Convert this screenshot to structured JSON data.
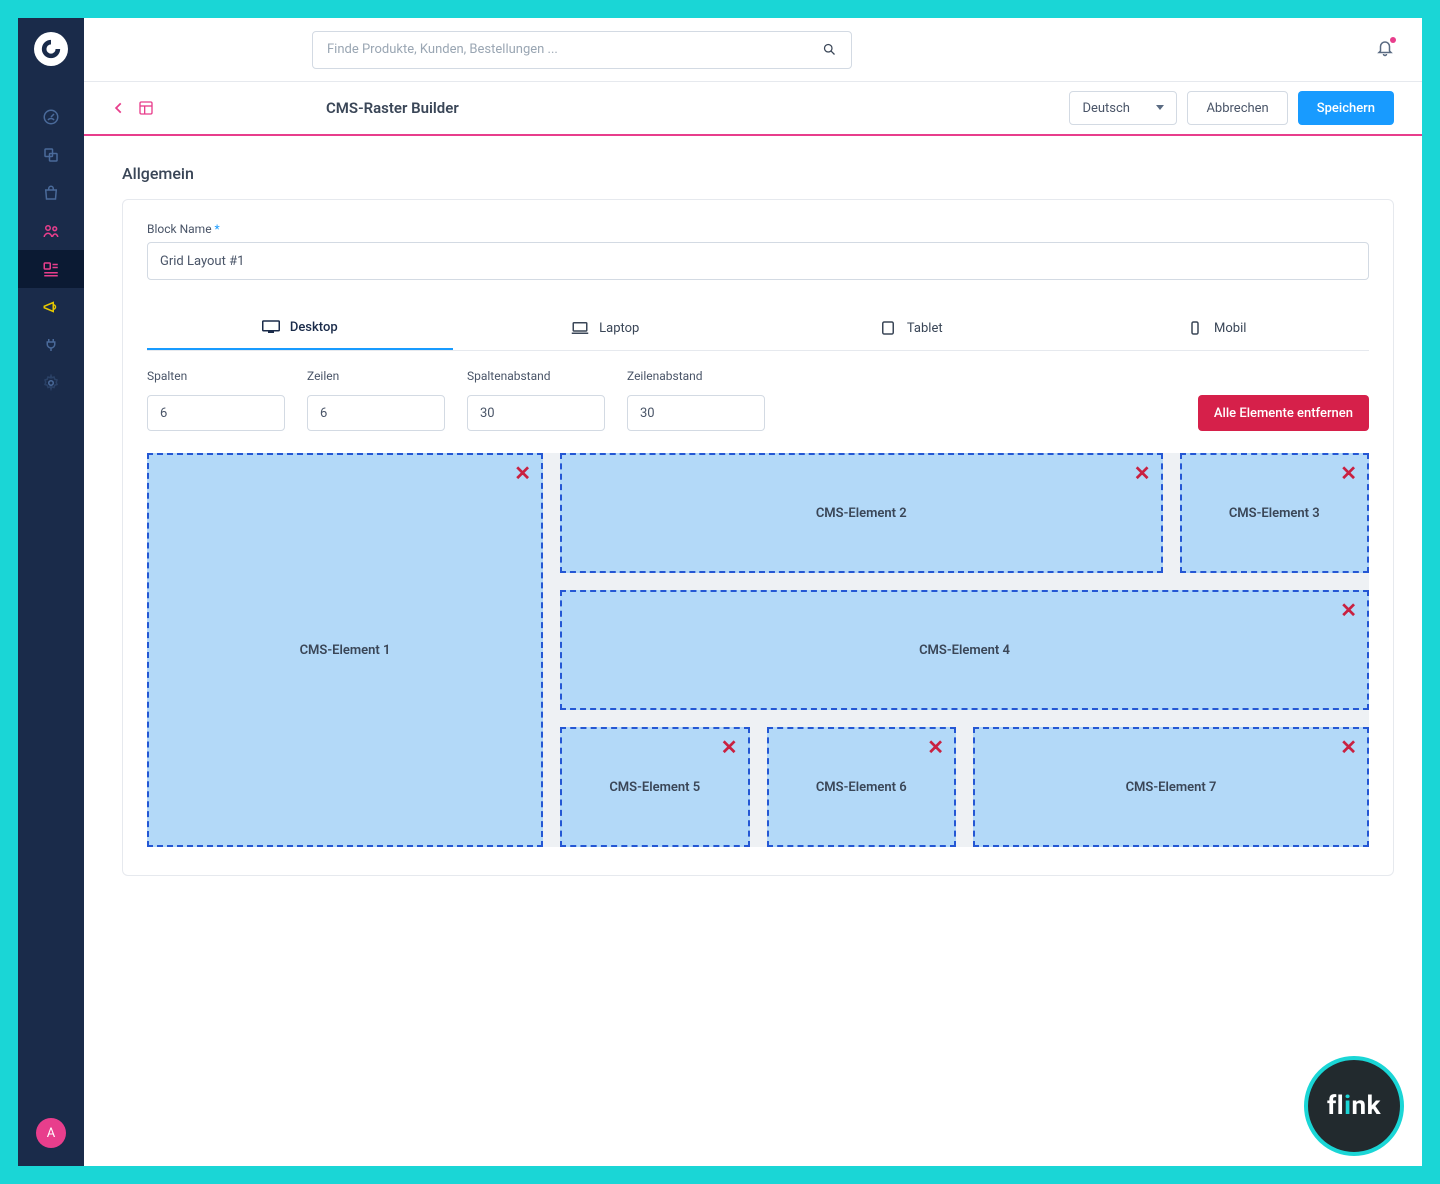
{
  "topbar": {
    "search_placeholder": "Finde Produkte, Kunden, Bestellungen ..."
  },
  "subbar": {
    "title": "CMS-Raster Builder",
    "language": "Deutsch",
    "cancel": "Abbrechen",
    "save": "Speichern"
  },
  "section": {
    "general": "Allgemein",
    "block_name_label": "Block Name",
    "block_name_value": "Grid Layout #1"
  },
  "tabs": {
    "desktop": "Desktop",
    "laptop": "Laptop",
    "tablet": "Tablet",
    "mobile": "Mobil"
  },
  "grid_controls": {
    "columns_label": "Spalten",
    "columns_value": "6",
    "rows_label": "Zeilen",
    "rows_value": "6",
    "col_gap_label": "Spaltenabstand",
    "col_gap_value": "30",
    "row_gap_label": "Zeilenabstand",
    "row_gap_value": "30",
    "remove_all": "Alle Elemente entfernen"
  },
  "elements": [
    {
      "label": "CMS-Element 1",
      "col": "1 / 3",
      "row": "1 / 4"
    },
    {
      "label": "CMS-Element 2",
      "col": "3 / 6",
      "row": "1 / 2"
    },
    {
      "label": "CMS-Element 3",
      "col": "6 / 7",
      "row": "1 / 2"
    },
    {
      "label": "CMS-Element 4",
      "col": "3 / 7",
      "row": "2 / 3"
    },
    {
      "label": "CMS-Element 5",
      "col": "3 / 4",
      "row": "3 / 4"
    },
    {
      "label": "CMS-Element 6",
      "col": "4 / 5",
      "row": "3 / 4"
    },
    {
      "label": "CMS-Element 7",
      "col": "5 / 7",
      "row": "3 / 4"
    }
  ],
  "avatar": "A",
  "flink": "flink"
}
